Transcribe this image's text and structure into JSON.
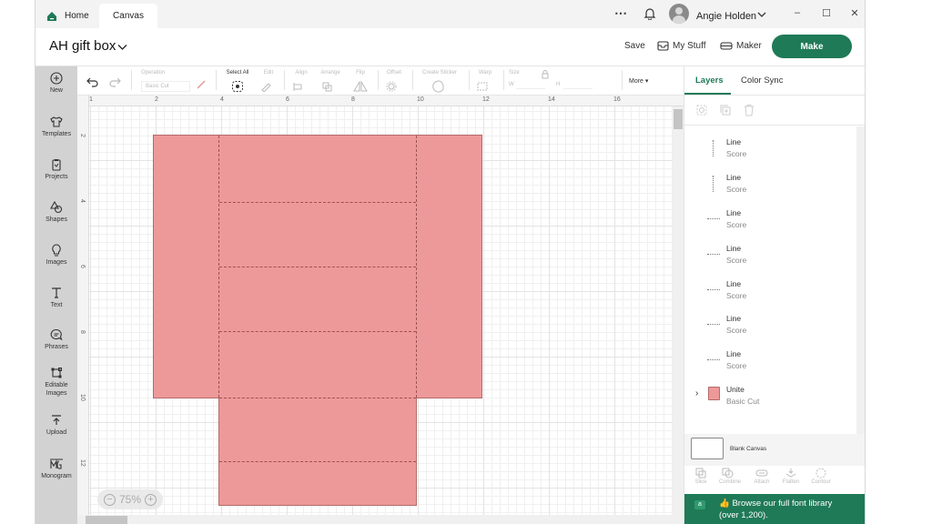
{
  "titlebar": {
    "tabs": [
      {
        "label": "Home",
        "icon": "home-icon"
      },
      {
        "label": "Canvas"
      }
    ],
    "more_icon": "⋯",
    "username": "Angie Holden",
    "window_controls": {
      "minimize": "–",
      "maximize": "☐",
      "close": "✕"
    }
  },
  "header": {
    "project_title": "AH gift box",
    "save_label": "Save",
    "my_stuff_label": "My Stuff",
    "maker_label": "Maker",
    "make_label": "Make"
  },
  "sidebar": {
    "items": [
      {
        "label": "New",
        "icon": "plus-circle-icon"
      },
      {
        "label": "Templates",
        "icon": "shirt-icon"
      },
      {
        "label": "Projects",
        "icon": "clipboard-icon"
      },
      {
        "label": "Shapes",
        "icon": "shapes-icon"
      },
      {
        "label": "Images",
        "icon": "lightbulb-icon"
      },
      {
        "label": "Text",
        "icon": "text-icon"
      },
      {
        "label": "Phrases",
        "icon": "speech-bubble-icon"
      },
      {
        "label": "Editable",
        "label2": "Images",
        "icon": "editable-images-icon"
      },
      {
        "label": "Upload",
        "icon": "upload-icon"
      },
      {
        "label": "Monogram",
        "icon": "monogram-icon"
      }
    ]
  },
  "toolbar": {
    "operation_label": "Operation",
    "operation_value": "Basic Cut",
    "select_all_label": "Select All",
    "edit_label": "Edit",
    "align_label": "Align",
    "arrange_label": "Arrange",
    "flip_label": "Flip",
    "offset_label": "Offset",
    "create_sticker_label": "Create Sticker",
    "warp_label": "Warp",
    "size_label": "Size",
    "size_w_label": "W",
    "size_h_label": "H",
    "more_label": "More ▾"
  },
  "canvas": {
    "ruler_x": [
      "1",
      "2",
      "4",
      "6",
      "8",
      "10",
      "12",
      "14",
      "16"
    ],
    "ruler_y": [
      "2",
      "4",
      "6",
      "8",
      "10",
      "12"
    ],
    "zoom_level": "75%",
    "shape_color": "#ee9999"
  },
  "panel": {
    "tabs": [
      {
        "label": "Layers",
        "active": true
      },
      {
        "label": "Color Sync"
      }
    ],
    "layers": [
      {
        "name": "Line",
        "type": "Score",
        "orientation": "vertical"
      },
      {
        "name": "Line",
        "type": "Score",
        "orientation": "vertical"
      },
      {
        "name": "Line",
        "type": "Score",
        "orientation": "horizontal"
      },
      {
        "name": "Line",
        "type": "Score",
        "orientation": "horizontal"
      },
      {
        "name": "Line",
        "type": "Score",
        "orientation": "horizontal"
      },
      {
        "name": "Line",
        "type": "Score",
        "orientation": "horizontal"
      },
      {
        "name": "Line",
        "type": "Score",
        "orientation": "horizontal"
      },
      {
        "name": "Unite",
        "type": "Basic Cut",
        "group": true
      }
    ],
    "blank_canvas_label": "Blank Canvas",
    "bottom_tools": [
      "Slice",
      "Combine",
      "Attach",
      "Flatten",
      "Contour"
    ],
    "promo_line1": "👍 Browse our full font library",
    "promo_line2": "(over 1,200).",
    "promo_badge": "a"
  },
  "colors": {
    "accent": "#1f7a57",
    "shape_fill": "#ee9999",
    "sidebar_bg": "#d2d2d2"
  }
}
